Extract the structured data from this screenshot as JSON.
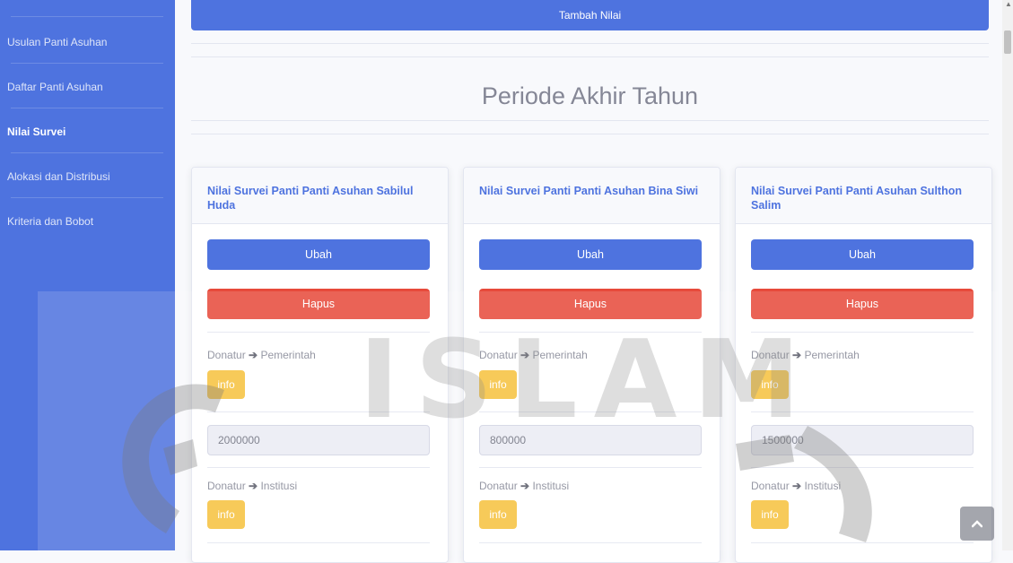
{
  "sidebar": {
    "items": [
      {
        "label": "Usulan Panti Asuhan"
      },
      {
        "label": "Daftar Panti Asuhan"
      },
      {
        "label": "Nilai Survei"
      },
      {
        "label": "Alokasi dan Distribusi"
      },
      {
        "label": "Kriteria dan Bobot"
      }
    ]
  },
  "top_button": "Tambah Nilai",
  "period_title": "Periode Akhir Tahun",
  "cards": [
    {
      "title": "Nilai Survei Panti Panti Asuhan Sabilul Huda",
      "ubah": "Ubah",
      "hapus": "Hapus",
      "criteria": [
        {
          "from": "Donatur",
          "to": "Pemerintah",
          "info": "info",
          "value": "2000000"
        },
        {
          "from": "Donatur",
          "to": "Institusi",
          "info": "info"
        }
      ]
    },
    {
      "title": "Nilai Survei Panti Panti Asuhan Bina Siwi",
      "ubah": "Ubah",
      "hapus": "Hapus",
      "criteria": [
        {
          "from": "Donatur",
          "to": "Pemerintah",
          "info": "info",
          "value": "800000"
        },
        {
          "from": "Donatur",
          "to": "Institusi",
          "info": "info"
        }
      ]
    },
    {
      "title": "Nilai Survei Panti Panti Asuhan Sulthon Salim",
      "ubah": "Ubah",
      "hapus": "Hapus",
      "criteria": [
        {
          "from": "Donatur",
          "to": "Pemerintah",
          "info": "info",
          "value": "1500000"
        },
        {
          "from": "Donatur",
          "to": "Institusi",
          "info": "info"
        }
      ]
    }
  ],
  "watermark": {
    "text": "ISLAM"
  },
  "icons": {
    "arrow": "arrow-right-icon",
    "scroll_top": "chevron-up-icon"
  }
}
